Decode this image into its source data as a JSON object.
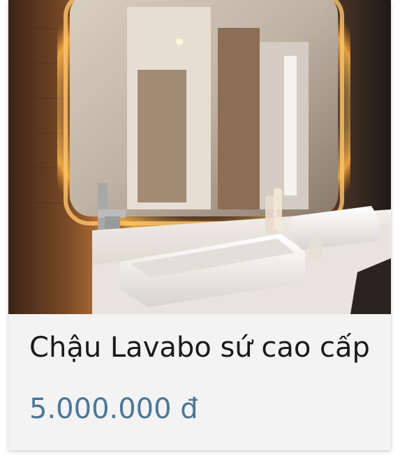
{
  "product": {
    "title": "Chậu Lavabo sứ cao cấp",
    "price": "5.000.000 đ",
    "image_subject": "bathroom-vanity-photo"
  },
  "colors": {
    "price": "#4b7796",
    "title": "#1a1a1a",
    "card_background": "#f3f3f3"
  }
}
